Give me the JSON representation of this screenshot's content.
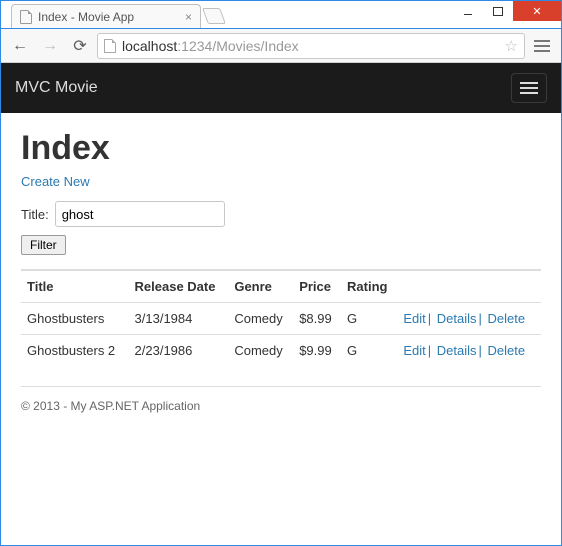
{
  "window": {
    "tab_title": "Index - Movie App"
  },
  "browser": {
    "url_host": "localhost",
    "url_port": ":1234",
    "url_path": "/Movies/Index"
  },
  "navbar": {
    "brand": "MVC Movie"
  },
  "page": {
    "heading": "Index",
    "create_link": "Create New",
    "title_label": "Title:",
    "title_value": "ghost",
    "filter_button": "Filter"
  },
  "table": {
    "headers": {
      "title": "Title",
      "release": "Release Date",
      "genre": "Genre",
      "price": "Price",
      "rating": "Rating"
    },
    "rows": [
      {
        "title": "Ghostbusters",
        "release": "3/13/1984",
        "genre": "Comedy",
        "price": "$8.99",
        "rating": "G"
      },
      {
        "title": "Ghostbusters 2",
        "release": "2/23/1986",
        "genre": "Comedy",
        "price": "$9.99",
        "rating": "G"
      }
    ],
    "actions": {
      "edit": "Edit",
      "details": "Details",
      "delete": "Delete"
    }
  },
  "footer": {
    "text": "© 2013 - My ASP.NET Application"
  }
}
